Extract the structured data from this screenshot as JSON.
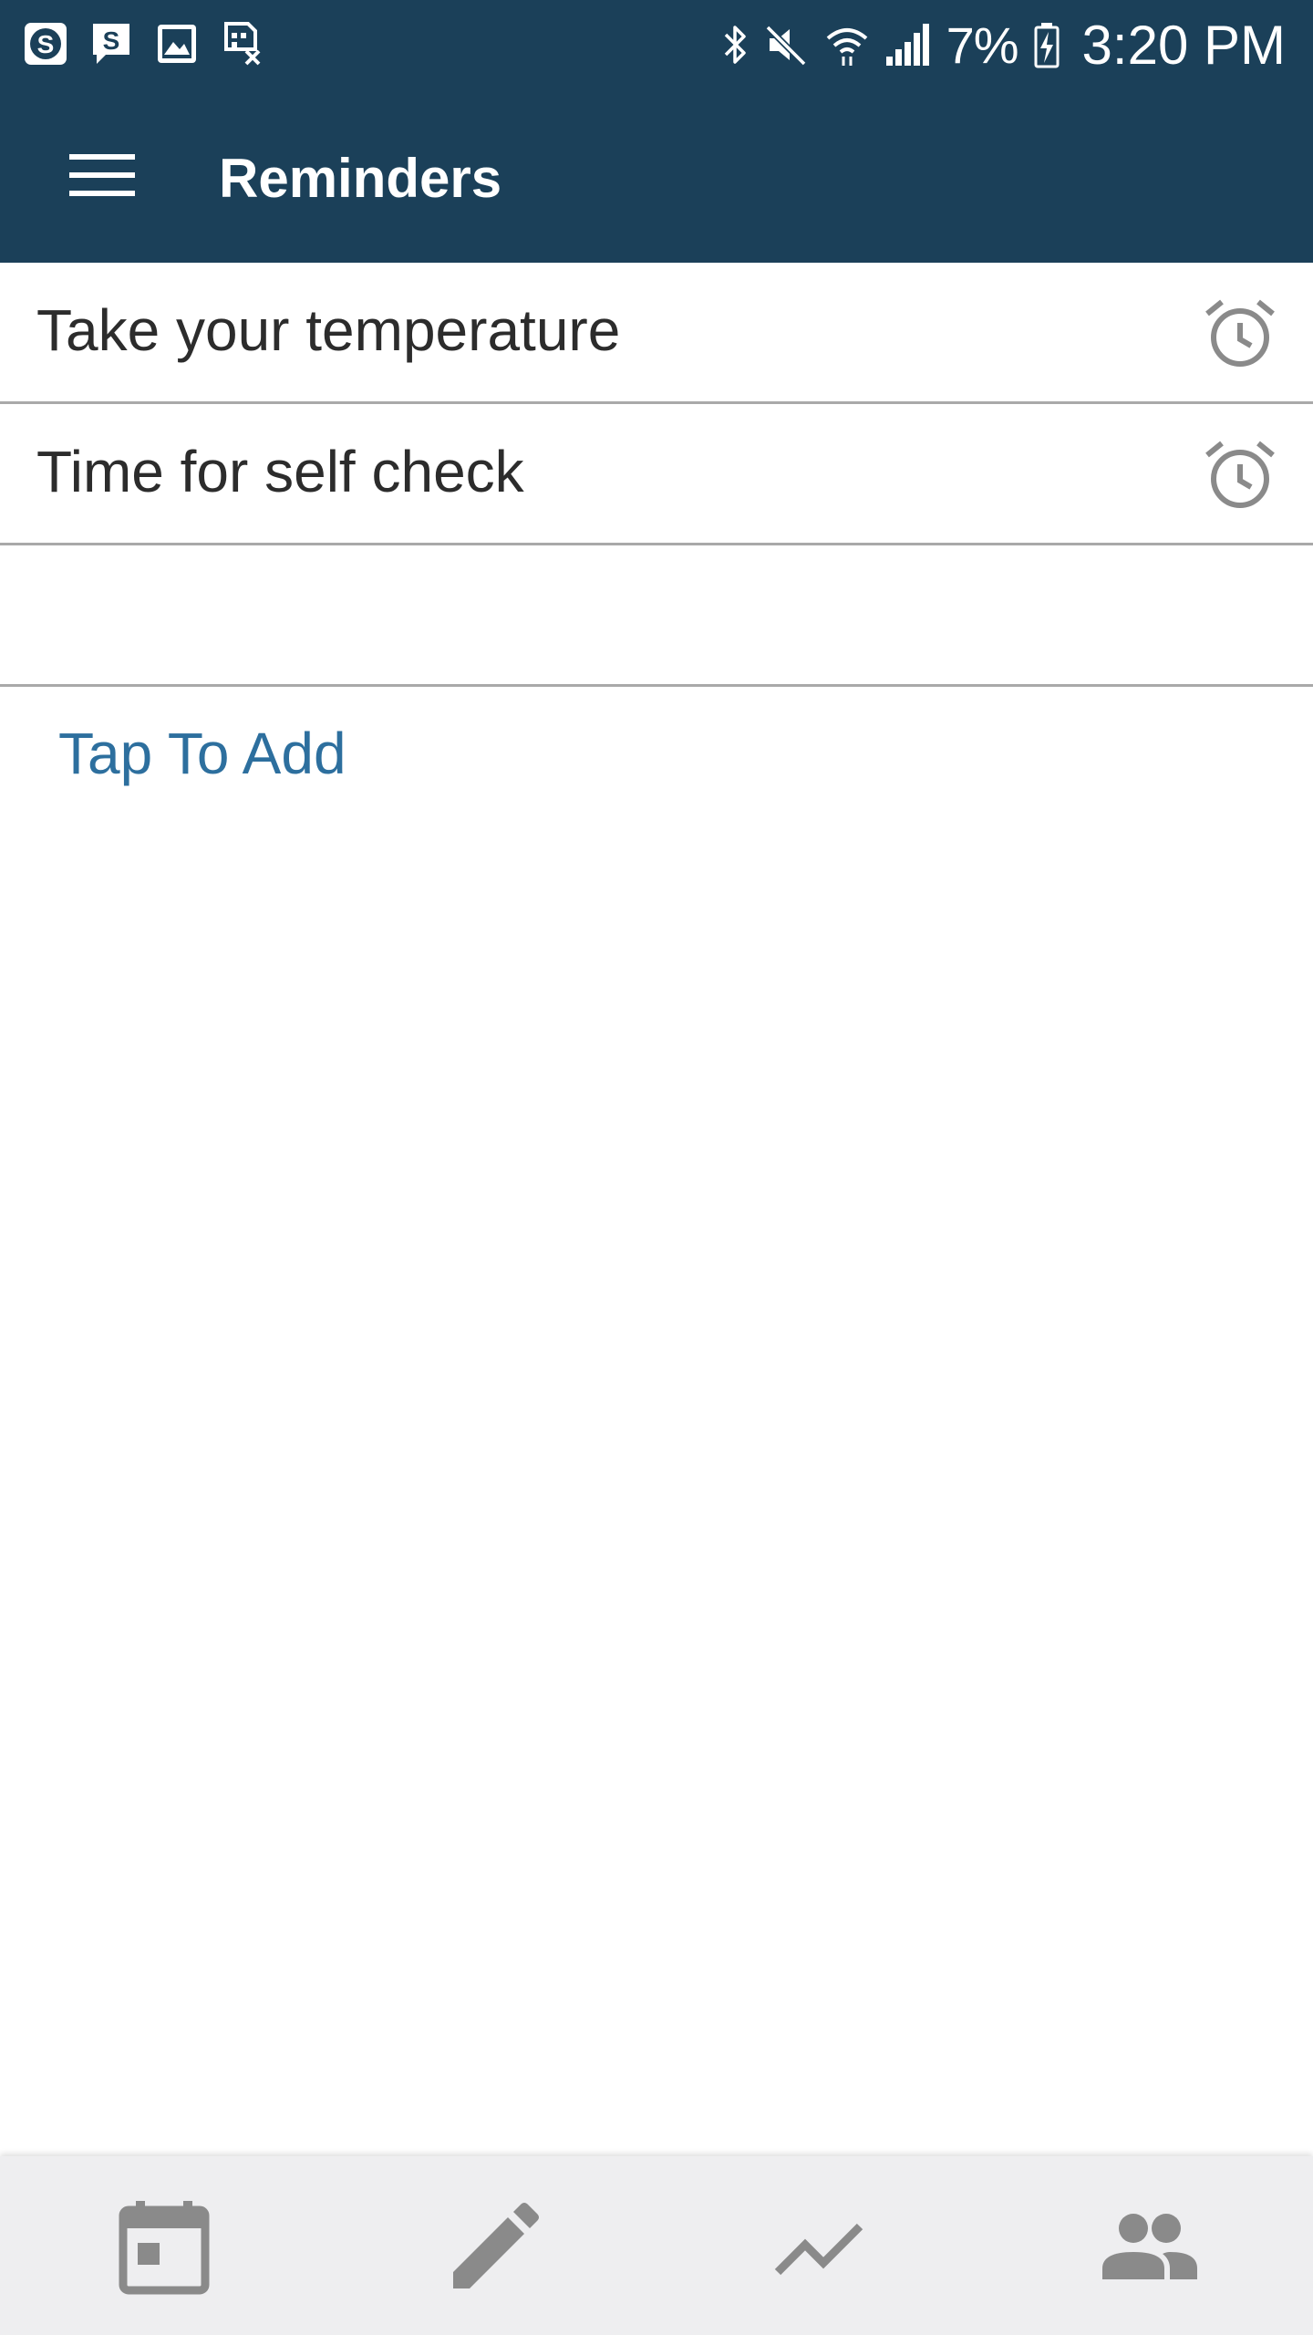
{
  "status_bar": {
    "battery": "7%",
    "time": "3:20 PM",
    "left_icons": [
      "s-app-icon",
      "s-chat-icon",
      "image-icon",
      "no-sim-icon"
    ],
    "right_icons": [
      "bluetooth-icon",
      "mute-icon",
      "wifi-icon",
      "signal-icon",
      "battery-charging-icon"
    ]
  },
  "app_bar": {
    "title": "Reminders",
    "menu_icon": "hamburger-menu-icon"
  },
  "reminders": [
    {
      "label": "Take your temperature",
      "icon": "alarm-icon"
    },
    {
      "label": "Time for self check",
      "icon": "alarm-icon"
    },
    {
      "label": "",
      "icon": ""
    }
  ],
  "add_link": "Tap To Add",
  "bottom_nav": {
    "items": [
      {
        "icon": "calendar-icon"
      },
      {
        "icon": "pencil-icon"
      },
      {
        "icon": "trend-chart-icon"
      },
      {
        "icon": "people-icon"
      }
    ]
  },
  "colors": {
    "app_bar": "#1b4059",
    "link": "#2d6f9e",
    "icon_gray": "#8a8a8a",
    "divider": "#a9a9a9",
    "bottom_nav_bg": "#eeeef0"
  }
}
